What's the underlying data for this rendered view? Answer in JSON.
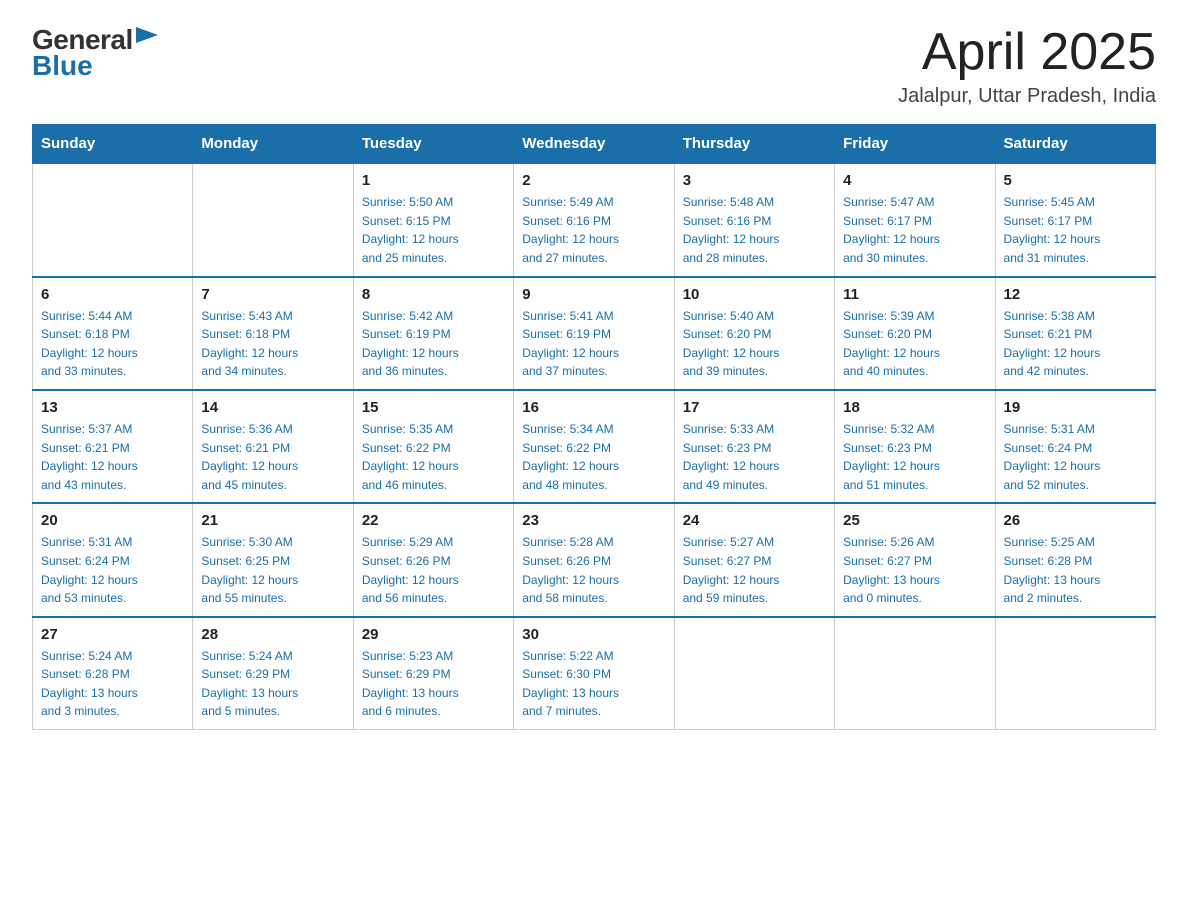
{
  "header": {
    "logo_general": "General",
    "logo_blue": "Blue",
    "month_title": "April 2025",
    "location": "Jalalpur, Uttar Pradesh, India"
  },
  "days_of_week": [
    "Sunday",
    "Monday",
    "Tuesday",
    "Wednesday",
    "Thursday",
    "Friday",
    "Saturday"
  ],
  "weeks": [
    [
      {
        "day": "",
        "info": ""
      },
      {
        "day": "",
        "info": ""
      },
      {
        "day": "1",
        "info": "Sunrise: 5:50 AM\nSunset: 6:15 PM\nDaylight: 12 hours\nand 25 minutes."
      },
      {
        "day": "2",
        "info": "Sunrise: 5:49 AM\nSunset: 6:16 PM\nDaylight: 12 hours\nand 27 minutes."
      },
      {
        "day": "3",
        "info": "Sunrise: 5:48 AM\nSunset: 6:16 PM\nDaylight: 12 hours\nand 28 minutes."
      },
      {
        "day": "4",
        "info": "Sunrise: 5:47 AM\nSunset: 6:17 PM\nDaylight: 12 hours\nand 30 minutes."
      },
      {
        "day": "5",
        "info": "Sunrise: 5:45 AM\nSunset: 6:17 PM\nDaylight: 12 hours\nand 31 minutes."
      }
    ],
    [
      {
        "day": "6",
        "info": "Sunrise: 5:44 AM\nSunset: 6:18 PM\nDaylight: 12 hours\nand 33 minutes."
      },
      {
        "day": "7",
        "info": "Sunrise: 5:43 AM\nSunset: 6:18 PM\nDaylight: 12 hours\nand 34 minutes."
      },
      {
        "day": "8",
        "info": "Sunrise: 5:42 AM\nSunset: 6:19 PM\nDaylight: 12 hours\nand 36 minutes."
      },
      {
        "day": "9",
        "info": "Sunrise: 5:41 AM\nSunset: 6:19 PM\nDaylight: 12 hours\nand 37 minutes."
      },
      {
        "day": "10",
        "info": "Sunrise: 5:40 AM\nSunset: 6:20 PM\nDaylight: 12 hours\nand 39 minutes."
      },
      {
        "day": "11",
        "info": "Sunrise: 5:39 AM\nSunset: 6:20 PM\nDaylight: 12 hours\nand 40 minutes."
      },
      {
        "day": "12",
        "info": "Sunrise: 5:38 AM\nSunset: 6:21 PM\nDaylight: 12 hours\nand 42 minutes."
      }
    ],
    [
      {
        "day": "13",
        "info": "Sunrise: 5:37 AM\nSunset: 6:21 PM\nDaylight: 12 hours\nand 43 minutes."
      },
      {
        "day": "14",
        "info": "Sunrise: 5:36 AM\nSunset: 6:21 PM\nDaylight: 12 hours\nand 45 minutes."
      },
      {
        "day": "15",
        "info": "Sunrise: 5:35 AM\nSunset: 6:22 PM\nDaylight: 12 hours\nand 46 minutes."
      },
      {
        "day": "16",
        "info": "Sunrise: 5:34 AM\nSunset: 6:22 PM\nDaylight: 12 hours\nand 48 minutes."
      },
      {
        "day": "17",
        "info": "Sunrise: 5:33 AM\nSunset: 6:23 PM\nDaylight: 12 hours\nand 49 minutes."
      },
      {
        "day": "18",
        "info": "Sunrise: 5:32 AM\nSunset: 6:23 PM\nDaylight: 12 hours\nand 51 minutes."
      },
      {
        "day": "19",
        "info": "Sunrise: 5:31 AM\nSunset: 6:24 PM\nDaylight: 12 hours\nand 52 minutes."
      }
    ],
    [
      {
        "day": "20",
        "info": "Sunrise: 5:31 AM\nSunset: 6:24 PM\nDaylight: 12 hours\nand 53 minutes."
      },
      {
        "day": "21",
        "info": "Sunrise: 5:30 AM\nSunset: 6:25 PM\nDaylight: 12 hours\nand 55 minutes."
      },
      {
        "day": "22",
        "info": "Sunrise: 5:29 AM\nSunset: 6:26 PM\nDaylight: 12 hours\nand 56 minutes."
      },
      {
        "day": "23",
        "info": "Sunrise: 5:28 AM\nSunset: 6:26 PM\nDaylight: 12 hours\nand 58 minutes."
      },
      {
        "day": "24",
        "info": "Sunrise: 5:27 AM\nSunset: 6:27 PM\nDaylight: 12 hours\nand 59 minutes."
      },
      {
        "day": "25",
        "info": "Sunrise: 5:26 AM\nSunset: 6:27 PM\nDaylight: 13 hours\nand 0 minutes."
      },
      {
        "day": "26",
        "info": "Sunrise: 5:25 AM\nSunset: 6:28 PM\nDaylight: 13 hours\nand 2 minutes."
      }
    ],
    [
      {
        "day": "27",
        "info": "Sunrise: 5:24 AM\nSunset: 6:28 PM\nDaylight: 13 hours\nand 3 minutes."
      },
      {
        "day": "28",
        "info": "Sunrise: 5:24 AM\nSunset: 6:29 PM\nDaylight: 13 hours\nand 5 minutes."
      },
      {
        "day": "29",
        "info": "Sunrise: 5:23 AM\nSunset: 6:29 PM\nDaylight: 13 hours\nand 6 minutes."
      },
      {
        "day": "30",
        "info": "Sunrise: 5:22 AM\nSunset: 6:30 PM\nDaylight: 13 hours\nand 7 minutes."
      },
      {
        "day": "",
        "info": ""
      },
      {
        "day": "",
        "info": ""
      },
      {
        "day": "",
        "info": ""
      }
    ]
  ]
}
